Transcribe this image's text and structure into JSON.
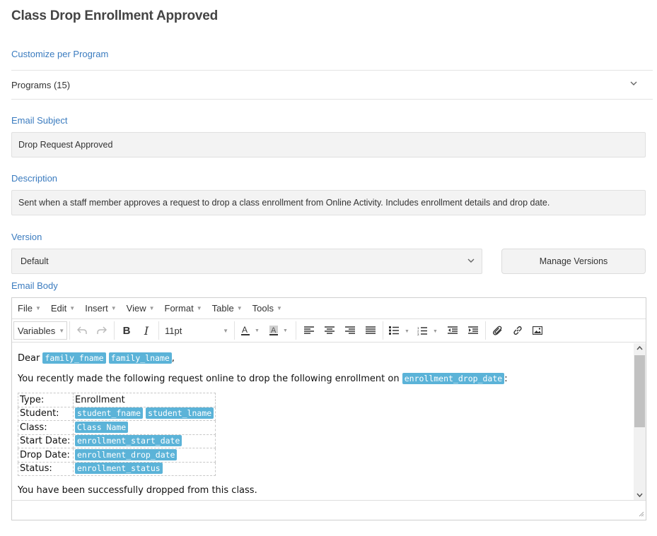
{
  "page": {
    "title": "Class Drop Enrollment Approved",
    "customize_label": "Customize per Program",
    "programs_label": "Programs (15)",
    "subject_label": "Email Subject",
    "subject_value": "Drop Request Approved",
    "description_label": "Description",
    "description_value": "Sent when a staff member approves a request to drop a class enrollment from Online Activity. Includes enrollment details and drop date.",
    "version_label": "Version",
    "version_value": "Default",
    "manage_versions_label": "Manage Versions",
    "body_label": "Email Body"
  },
  "editor": {
    "menus": [
      "File",
      "Edit",
      "Insert",
      "View",
      "Format",
      "Table",
      "Tools"
    ],
    "toolbar": {
      "styles_dropdown": "Variables",
      "font_size": "11pt",
      "icons": [
        "undo-icon",
        "redo-icon",
        "bold-icon",
        "italic-icon",
        "text-color-icon",
        "background-color-icon",
        "align-left-icon",
        "align-center-icon",
        "align-right-icon",
        "align-justify-icon",
        "bullet-list-icon",
        "numbered-list-icon",
        "outdent-icon",
        "indent-icon",
        "attachment-icon",
        "link-icon",
        "image-icon"
      ]
    },
    "body": {
      "greeting": "Dear",
      "tag_fname": "family_fname",
      "tag_lname": "family_lname",
      "greeting_end": ",",
      "intro": "You recently made the following request online to drop the following enrollment on",
      "tag_drop_date_inline": "enrollment_drop_date",
      "intro_end": ":",
      "table": {
        "type_label": "Type:",
        "type_value": "Enrollment",
        "student_label": "Student:",
        "student_tag1": "student_fname",
        "student_tag2": "student_lname",
        "class_label": "Class:",
        "class_tag": "Class Name",
        "start_label": "Start Date:",
        "start_tag": "enrollment_start_date",
        "drop_label": "Drop Date:",
        "drop_tag": "enrollment_drop_date",
        "status_label": "Status:",
        "status_tag": "enrollment_status"
      },
      "closing": "You have been successfully dropped from this class."
    }
  },
  "colors": {
    "label_blue": "#3a7bbf",
    "tag_blue": "#5bb3d8",
    "field_bg": "#f3f3f3"
  }
}
